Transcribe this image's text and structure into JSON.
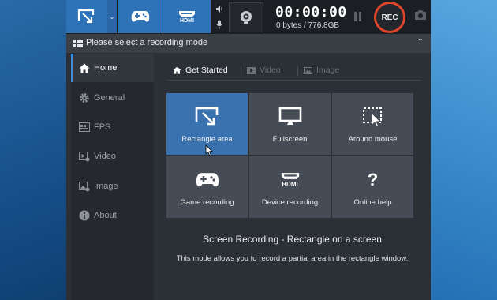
{
  "toolbar": {
    "modes": [
      {
        "id": "rectangle",
        "icon": "rectangle-arrow-icon"
      },
      {
        "id": "game",
        "icon": "gamepad-icon"
      },
      {
        "id": "device",
        "icon": "hdmi-icon",
        "label": "HDMI"
      }
    ],
    "dropdown_icon": "chevron-down-icon",
    "speaker_icon": "speaker-icon",
    "mic_icon": "microphone-icon",
    "webcam_icon": "webcam-icon",
    "timer": "00:00:00",
    "bytes": "0 bytes / 776.8GB",
    "pause_icon": "pause-icon",
    "rec_label": "REC",
    "screenshot_icon": "camera-icon"
  },
  "mode_header": {
    "text": "Please select a recording mode",
    "icon": "grid-icon",
    "collapse_icon": "chevron-up-icon"
  },
  "sidebar": {
    "items": [
      {
        "label": "Home",
        "icon": "home-icon",
        "active": true
      },
      {
        "label": "General",
        "icon": "gear-icon"
      },
      {
        "label": "FPS",
        "icon": "fps-icon"
      },
      {
        "label": "Video",
        "icon": "video-icon"
      },
      {
        "label": "Image",
        "icon": "image-icon"
      },
      {
        "label": "About",
        "icon": "info-icon"
      }
    ]
  },
  "main": {
    "tabs": [
      {
        "label": "Get Started",
        "active": true
      },
      {
        "label": "Video"
      },
      {
        "label": "Image"
      }
    ],
    "tiles": [
      {
        "label": "Rectangle area",
        "icon": "rectangle-arrow-icon",
        "selected": true
      },
      {
        "label": "Fullscreen",
        "icon": "monitor-icon"
      },
      {
        "label": "Around mouse",
        "icon": "around-mouse-icon"
      },
      {
        "label": "Game recording",
        "icon": "gamepad-icon"
      },
      {
        "label": "Device recording",
        "icon": "hdmi-icon",
        "icon_text": "HDMI"
      },
      {
        "label": "Online help",
        "icon": "question-icon",
        "icon_text": "?"
      }
    ],
    "description_title": "Screen Recording - Rectangle on a screen",
    "description_text": "This mode allows you to record a partial area in the rectangle window."
  },
  "colors": {
    "accent": "#2e72b8",
    "rec": "#e0452d",
    "tile": "#464c55",
    "tile_selected": "#3a72b0",
    "sidebar_active_bar": "#3c8fdc"
  }
}
